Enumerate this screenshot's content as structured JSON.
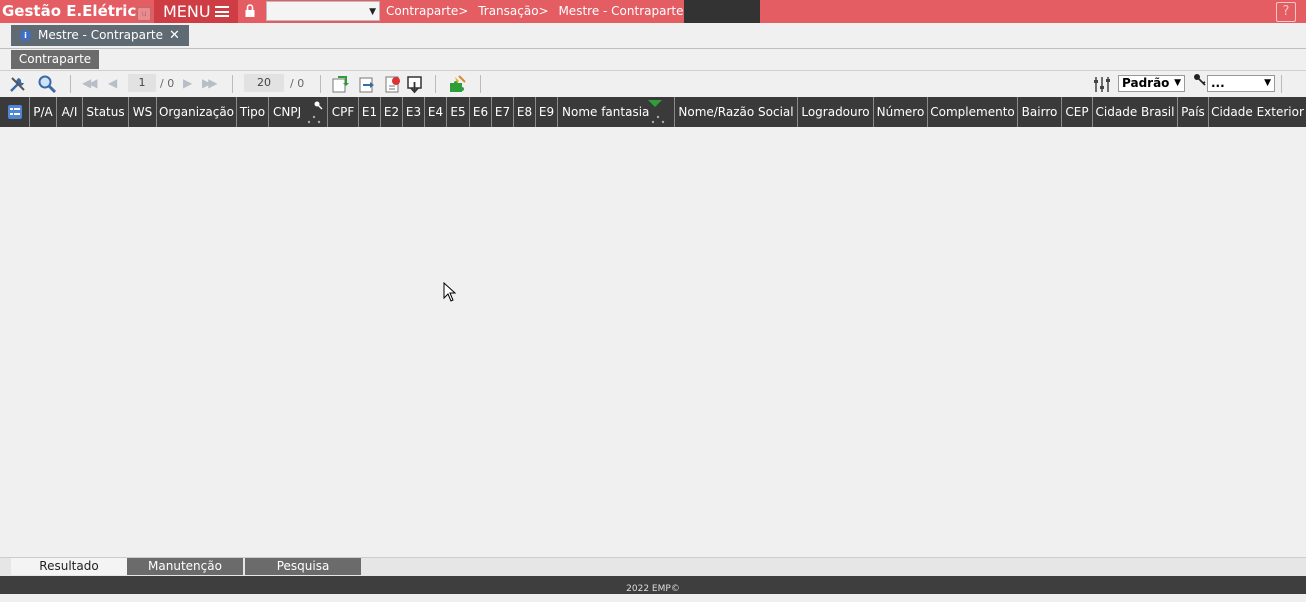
{
  "topbar": {
    "brand": "Gestão E.Elétrica",
    "menu_label": "MENU",
    "breadcrumbs": [
      "Contraparte>",
      "Transação>",
      "Mestre - Contraparte>"
    ],
    "help_label": "?",
    "colors": {
      "bar": "#e35d63",
      "menu": "#cf3d44",
      "dark": "#333333"
    }
  },
  "doc_tab": {
    "info_icon": "i",
    "title": "Mestre - Contraparte",
    "close": "✕"
  },
  "subtab": {
    "label": "Contraparte"
  },
  "toolbar": {
    "page_current": "1",
    "page_total": "/ 0",
    "page_size": "20",
    "size_total": "/ 0",
    "view_select": "Padrão",
    "filter_select": "...",
    "icons": [
      "tools-icon",
      "search-icon",
      "first-page-icon",
      "prev-page-icon",
      "next-page-icon",
      "last-page-icon",
      "refresh-icon",
      "export-icon",
      "print-icon",
      "download-icon",
      "puzzle-icon",
      "sliders-icon",
      "key-icon"
    ]
  },
  "grid": {
    "columns": [
      "P/A",
      "A/I",
      "Status",
      "WS",
      "Organização",
      "Tipo",
      "CNPJ",
      "CPF",
      "E1",
      "E2",
      "E3",
      "E4",
      "E5",
      "E6",
      "E7",
      "E8",
      "E9",
      "Nome fantasia",
      "Nome/Razão Social",
      "Logradouro",
      "Número",
      "Complemento",
      "Bairro",
      "CEP",
      "Cidade Brasil",
      "País",
      "Cidade Exterior"
    ],
    "rows": []
  },
  "bottom_tabs": [
    "Resultado",
    "Manutenção",
    "Pesquisa"
  ],
  "footer": "2022 EMP©"
}
